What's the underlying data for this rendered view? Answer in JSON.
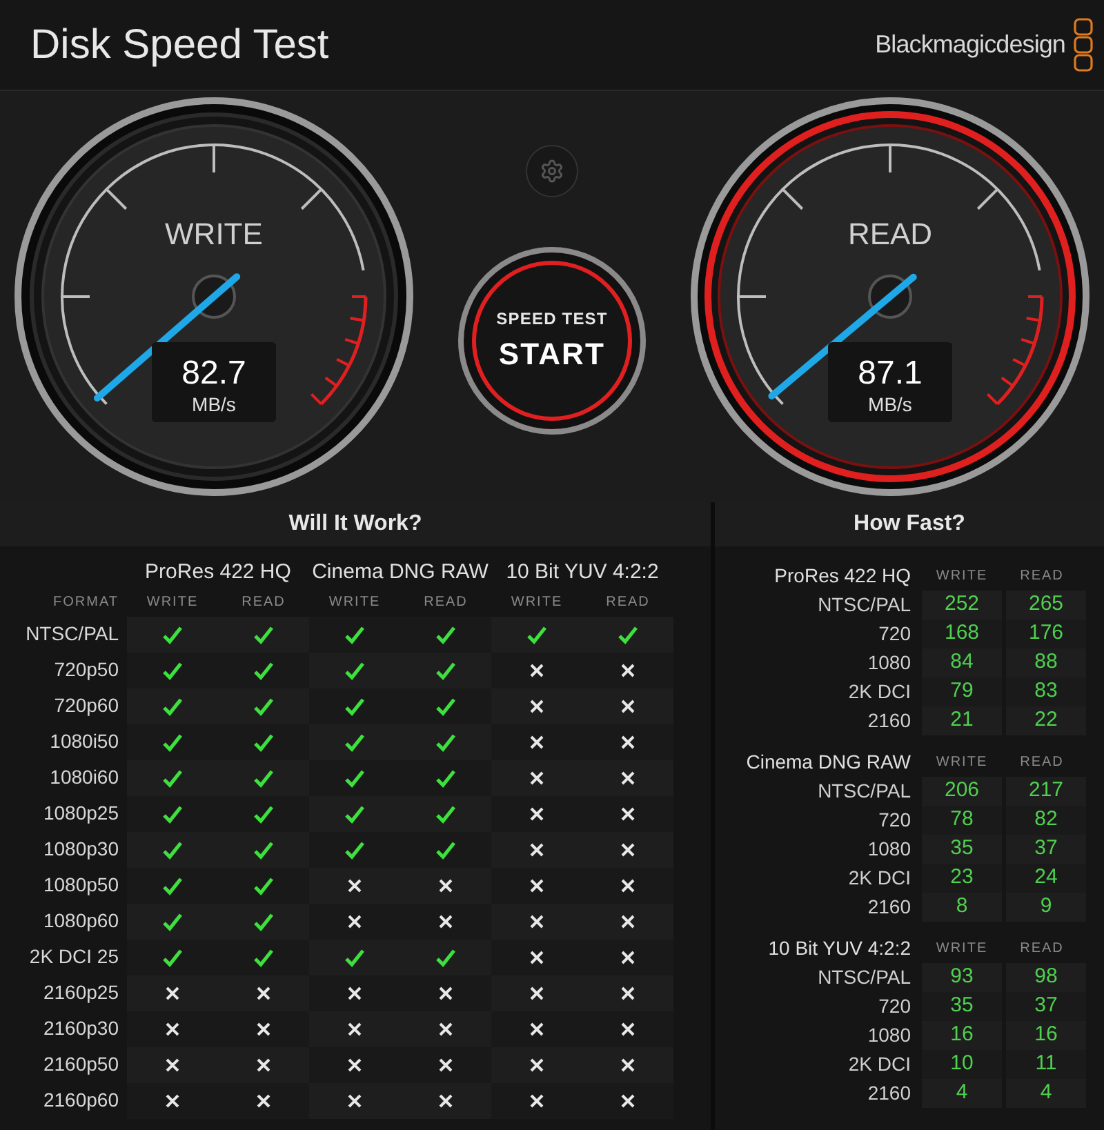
{
  "header": {
    "title": "Disk Speed Test",
    "brand": "Blackmagicdesign"
  },
  "gauges": [
    {
      "label": "WRITE",
      "reading": "82.7",
      "unit": "MB/s",
      "glow": false
    },
    {
      "label": "READ",
      "reading": "87.1",
      "unit": "MB/s",
      "glow": true
    }
  ],
  "start_button": {
    "caption": "SPEED TEST",
    "label": "START"
  },
  "will_it_work": {
    "title": "Will It Work?",
    "format_heading": "FORMAT",
    "codecs": [
      {
        "name": "ProRes 422 HQ",
        "columns": [
          "WRITE",
          "READ"
        ]
      },
      {
        "name": "Cinema DNG RAW",
        "columns": [
          "WRITE",
          "READ"
        ]
      },
      {
        "name": "10 Bit YUV 4:2:2",
        "columns": [
          "WRITE",
          "READ"
        ]
      }
    ],
    "rows": [
      {
        "format": "NTSC/PAL",
        "works": [
          true,
          true,
          true,
          true,
          true,
          true
        ]
      },
      {
        "format": "720p50",
        "works": [
          true,
          true,
          true,
          true,
          false,
          false
        ]
      },
      {
        "format": "720p60",
        "works": [
          true,
          true,
          true,
          true,
          false,
          false
        ]
      },
      {
        "format": "1080i50",
        "works": [
          true,
          true,
          true,
          true,
          false,
          false
        ]
      },
      {
        "format": "1080i60",
        "works": [
          true,
          true,
          true,
          true,
          false,
          false
        ]
      },
      {
        "format": "1080p25",
        "works": [
          true,
          true,
          true,
          true,
          false,
          false
        ]
      },
      {
        "format": "1080p30",
        "works": [
          true,
          true,
          true,
          true,
          false,
          false
        ]
      },
      {
        "format": "1080p50",
        "works": [
          true,
          true,
          false,
          false,
          false,
          false
        ]
      },
      {
        "format": "1080p60",
        "works": [
          true,
          true,
          false,
          false,
          false,
          false
        ]
      },
      {
        "format": "2K DCI 25",
        "works": [
          true,
          true,
          true,
          true,
          false,
          false
        ]
      },
      {
        "format": "2160p25",
        "works": [
          false,
          false,
          false,
          false,
          false,
          false
        ]
      },
      {
        "format": "2160p30",
        "works": [
          false,
          false,
          false,
          false,
          false,
          false
        ]
      },
      {
        "format": "2160p50",
        "works": [
          false,
          false,
          false,
          false,
          false,
          false
        ]
      },
      {
        "format": "2160p60",
        "works": [
          false,
          false,
          false,
          false,
          false,
          false
        ]
      }
    ]
  },
  "how_fast": {
    "title": "How Fast?",
    "groups": [
      {
        "codec": "ProRes 422 HQ",
        "columns": [
          "WRITE",
          "READ"
        ],
        "rows": [
          {
            "format": "NTSC/PAL",
            "write": "252",
            "read": "265"
          },
          {
            "format": "720",
            "write": "168",
            "read": "176"
          },
          {
            "format": "1080",
            "write": "84",
            "read": "88"
          },
          {
            "format": "2K DCI",
            "write": "79",
            "read": "83"
          },
          {
            "format": "2160",
            "write": "21",
            "read": "22"
          }
        ]
      },
      {
        "codec": "Cinema DNG RAW",
        "columns": [
          "WRITE",
          "READ"
        ],
        "rows": [
          {
            "format": "NTSC/PAL",
            "write": "206",
            "read": "217"
          },
          {
            "format": "720",
            "write": "78",
            "read": "82"
          },
          {
            "format": "1080",
            "write": "35",
            "read": "37"
          },
          {
            "format": "2K DCI",
            "write": "23",
            "read": "24"
          },
          {
            "format": "2160",
            "write": "8",
            "read": "9"
          }
        ]
      },
      {
        "codec": "10 Bit YUV 4:2:2",
        "columns": [
          "WRITE",
          "READ"
        ],
        "rows": [
          {
            "format": "NTSC/PAL",
            "write": "93",
            "read": "98"
          },
          {
            "format": "720",
            "write": "35",
            "read": "37"
          },
          {
            "format": "1080",
            "write": "16",
            "read": "16"
          },
          {
            "format": "2K DCI",
            "write": "10",
            "read": "11"
          },
          {
            "format": "2160",
            "write": "4",
            "read": "4"
          }
        ]
      }
    ]
  }
}
